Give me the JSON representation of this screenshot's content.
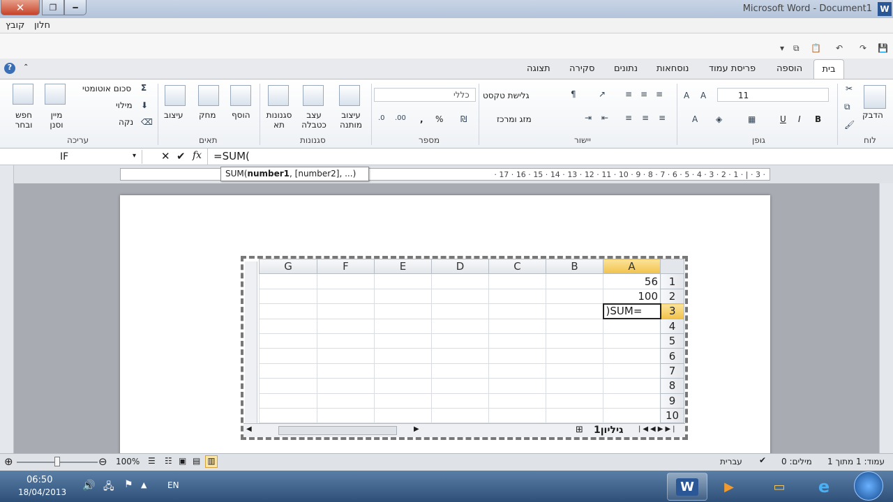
{
  "window": {
    "title": "Microsoft Word - Document1",
    "logo": "W",
    "close": "✕",
    "maximize": "❐",
    "minimize": "━"
  },
  "menu": {
    "items": [
      "קובץ",
      "חלון"
    ]
  },
  "tabs": [
    "בית",
    "הוספה",
    "פריסת עמוד",
    "נוסחאות",
    "נתונים",
    "סקירה",
    "תצוגה"
  ],
  "ribbon": {
    "clipboard": {
      "paste": "הדבק",
      "label": "לוח"
    },
    "font": {
      "size": "11",
      "label": "גופן",
      "bold": "B",
      "italic": "I",
      "underline": "U"
    },
    "alignment": {
      "wrap": "גלישת טקסט",
      "merge": "מזג ומרכז",
      "label": "יישור"
    },
    "number": {
      "format": "כללי",
      "label": "מספר",
      "percent": "%",
      "comma": ","
    },
    "styles": {
      "conditional": "עיצוב מותנה",
      "table": "עצב כטבלה",
      "cell": "סגנונות תא",
      "label": "סגנונות"
    },
    "cells": {
      "insert": "הוסף",
      "delete": "מחק",
      "format": "עיצוב",
      "label": "תאים"
    },
    "editing": {
      "autosum": "סכום אוטומטי",
      "fill": "מילוי",
      "clear": "נקה",
      "sort": "מיין וסנן",
      "find": "חפש ובחר",
      "label": "עריכה"
    }
  },
  "formula_bar": {
    "name_box": "IF",
    "formula": "=SUM(",
    "fx": "fx"
  },
  "tooltip": {
    "fn": "SUM(",
    "arg1": "number1",
    "rest": ", [number2], ...)"
  },
  "ruler": {
    "marks": "· 3 · | · 1 · 2 · 3 · 4 · 5 · 6 · 7 · 8 · 9 · 10 · 11 · 12 · 13 · 14 · 15 · 16 · 17 ·"
  },
  "sheet": {
    "columns": [
      "A",
      "B",
      "C",
      "D",
      "E",
      "F",
      "G"
    ],
    "rows": [
      {
        "n": "1",
        "a": "56"
      },
      {
        "n": "2",
        "a": "100"
      },
      {
        "n": "3",
        "a": "=SUM("
      },
      {
        "n": "4",
        "a": ""
      },
      {
        "n": "5",
        "a": ""
      },
      {
        "n": "6",
        "a": ""
      },
      {
        "n": "7",
        "a": ""
      },
      {
        "n": "8",
        "a": ""
      },
      {
        "n": "9",
        "a": ""
      },
      {
        "n": "10",
        "a": ""
      }
    ],
    "tab": "גיליון1"
  },
  "status": {
    "page": "עמוד: 1 מתוך 1",
    "words": "מילים: 0",
    "language": "עברית",
    "zoom": "100%"
  },
  "taskbar": {
    "lang": "EN",
    "time": "06:50",
    "date": "18/04/2013"
  }
}
